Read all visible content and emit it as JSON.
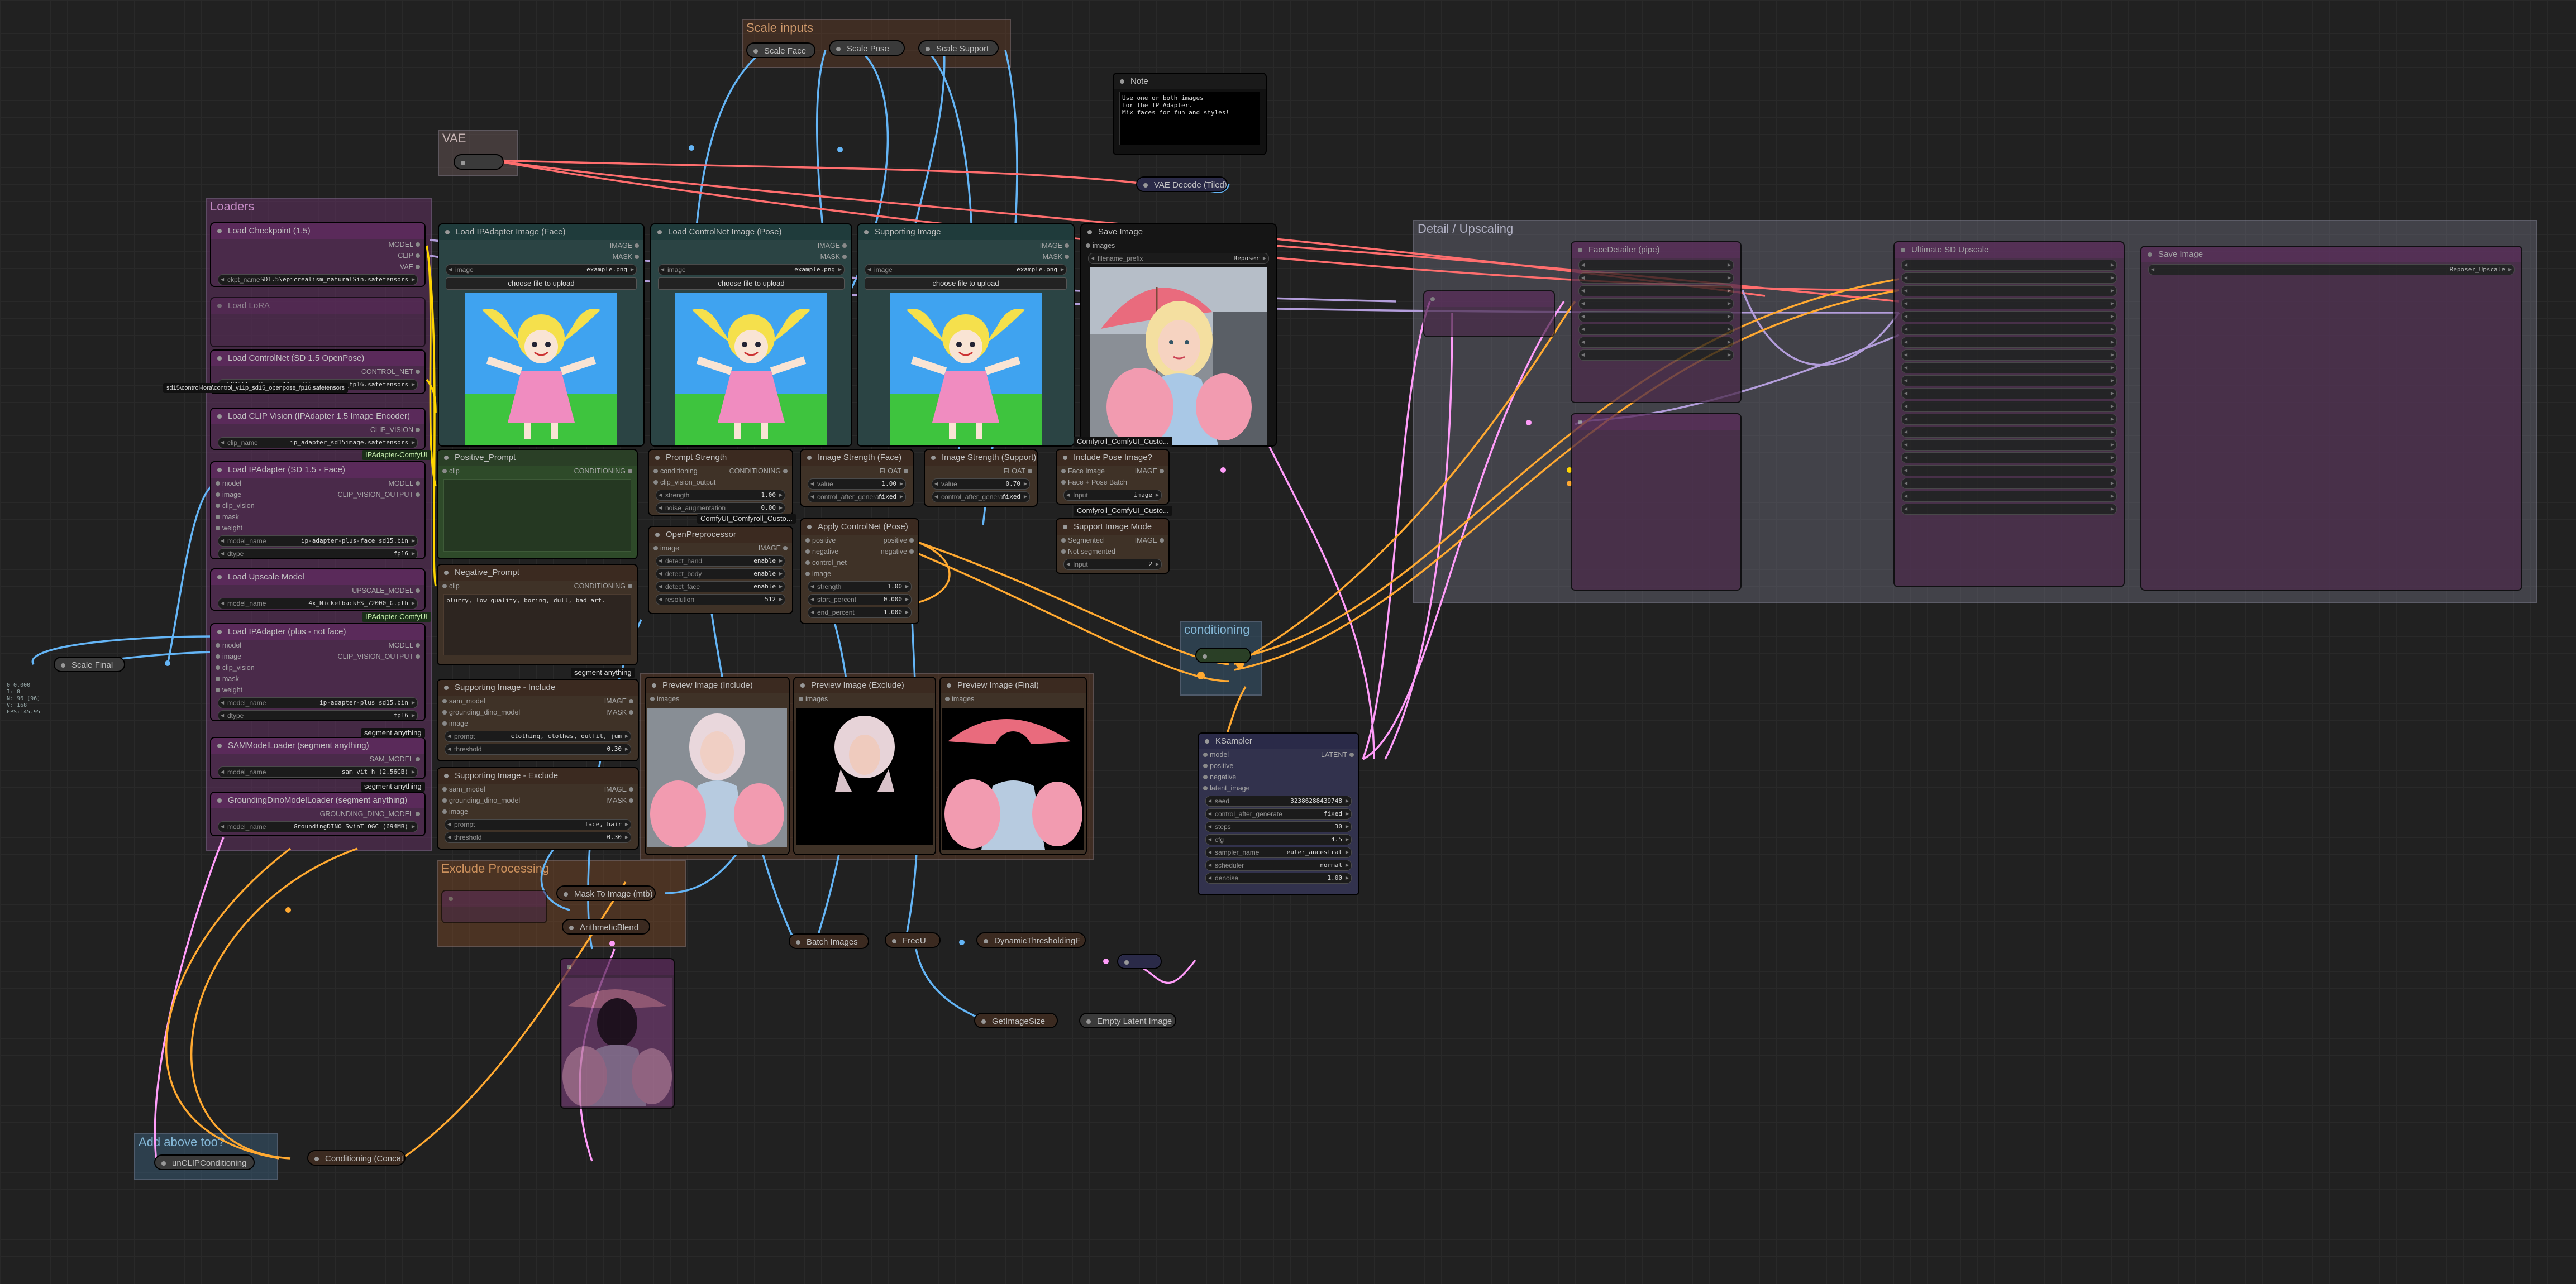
{
  "groups": {
    "scale_inputs": "Scale inputs",
    "vae": "VAE",
    "loaders": "Loaders",
    "detail_upscaling": "Detail / Upscaling",
    "conditioning": "conditioning",
    "exclude_processing": "Exclude Processing",
    "add_above": "Add above too?"
  },
  "nodes": {
    "scale_face": "Scale Face",
    "scale_pose": "Scale Pose",
    "scale_support": "Scale Support",
    "scale_final": "Scale Final",
    "note": {
      "title": "Note",
      "text": "Use one or both images\nfor the IP Adapter.\nMix faces for fun and styles!"
    },
    "vae_decode": "VAE Decode (Tiled)",
    "load_checkpoint": {
      "title": "Load Checkpoint (1.5)",
      "outs": [
        "MODEL",
        "CLIP",
        "VAE"
      ],
      "ckpt_label": "ckpt_name",
      "ckpt_value": "SD1.5\\epicrealism_naturalSin.safetensors"
    },
    "lora": {
      "title": "Load LoRA"
    },
    "load_controlnet": {
      "title": "Load ControlNet (SD 1.5 OpenPose)",
      "out": "CONTROL_NET",
      "label": "control_net_name",
      "value": "SD1.5\\control_v11p_sd15_openpose_fp16.safetensors",
      "chip": "sd15\\control-lora\\control_v11p_sd15_openpose_fp16.safetensors"
    },
    "load_clip_vision": {
      "title": "Load CLIP Vision (IPAdapter 1.5 Image Encoder)",
      "out": "CLIP_VISION",
      "label": "clip_name",
      "value": "ip_adapter_sd15image.safetensors"
    },
    "ipa_face": {
      "title": "Load IPAdapter (SD 1.5 - Face)",
      "ins": [
        "model",
        "image",
        "clip_vision",
        "mask",
        "weight"
      ],
      "outs": [
        "MODEL",
        "CLIP_VISION_OUTPUT"
      ],
      "w1l": "model_name",
      "w1v": "ip-adapter-plus-face_sd15.bin",
      "w2l": "dtype",
      "w2v": "fp16"
    },
    "upscale_model": {
      "title": "Load Upscale Model",
      "out": "UPSCALE_MODEL",
      "label": "model_name",
      "value": "4x_NickelbackFS_72000_G.pth"
    },
    "ipa_plus": {
      "title": "Load IPAdapter (plus - not face)",
      "ins": [
        "model",
        "image",
        "clip_vision",
        "mask",
        "weight"
      ],
      "outs": [
        "MODEL",
        "CLIP_VISION_OUTPUT"
      ],
      "w1l": "model_name",
      "w1v": "ip-adapter-plus_sd15.bin",
      "w2l": "dtype",
      "w2v": "fp16"
    },
    "sam": {
      "title": "SAMModelLoader (segment anything)",
      "out": "SAM_MODEL",
      "label": "model_name",
      "value": "sam_vit_h (2.56GB)"
    },
    "grounding": {
      "title": "GroundingDinoModelLoader (segment anything)",
      "out": "GROUNDING_DINO_MODEL",
      "label": "model_name",
      "value": "GroundingDINO_SwinT_OGC (694MB)"
    },
    "ipa_image_face": {
      "title": "Load IPAdapter Image (Face)",
      "outs": [
        "IMAGE",
        "MASK"
      ],
      "label": "image",
      "value": "example.png",
      "button": "choose file to upload"
    },
    "cn_image_pose": {
      "title": "Load ControlNet Image (Pose)",
      "outs": [
        "IMAGE",
        "MASK"
      ],
      "label": "image",
      "value": "example.png",
      "button": "choose file to upload"
    },
    "supporting_image": {
      "title": "Supporting Image",
      "outs": [
        "IMAGE",
        "MASK"
      ],
      "label": "image",
      "value": "example.png",
      "button": "choose file to upload"
    },
    "save_image": {
      "title": "Save Image",
      "in": "images",
      "prefix_value": "filename_prefix",
      "prefix_text": "Reposer"
    },
    "positive_prompt": {
      "title": "Positive_Prompt",
      "in": "clip",
      "out": "CONDITIONING"
    },
    "negative_prompt": {
      "title": "Negative_Prompt",
      "in": "clip",
      "out": "CONDITIONING",
      "text": "blurry, low quality, boring, dull, bad art."
    },
    "prompt_strength": {
      "title": "Prompt Strength",
      "ins": [
        "conditioning",
        "clip_vision_output"
      ],
      "out": "CONDITIONING",
      "w1l": "strength",
      "w1v": "1.00",
      "w2l": "noise_augmentation",
      "w2v": "0.00"
    },
    "img_strength_face": {
      "title": "Image Strength (Face)",
      "out": "FLOAT",
      "w1l": "value",
      "w1v": "1.00",
      "w2l": "control_after_generate",
      "w2v": "fixed"
    },
    "img_strength_support": {
      "title": "Image Strength (Support)",
      "out": "FLOAT",
      "w1l": "value",
      "w1v": "0.70",
      "w2l": "control_after_generate",
      "w2v": "fixed"
    },
    "include_pose": {
      "title": "Include Pose Image?",
      "ins": [
        "Face Image",
        "Face + Pose Batch"
      ],
      "out": "IMAGE",
      "w1l": "Input",
      "w1v": "image"
    },
    "openpose": {
      "title": "OpenPreprocessor",
      "in": "image",
      "out": "IMAGE",
      "w": [
        [
          "detect_hand",
          "enable"
        ],
        [
          "detect_body",
          "enable"
        ],
        [
          "detect_face",
          "enable"
        ],
        [
          "resolution",
          "512"
        ]
      ]
    },
    "apply_controlnet": {
      "title": "Apply ControlNet (Pose)",
      "ins": [
        "positive",
        "negative",
        "control_net",
        "image"
      ],
      "outs": [
        "positive",
        "negative"
      ],
      "w": [
        [
          "strength",
          "1.00"
        ],
        [
          "start_percent",
          "0.000"
        ],
        [
          "end_percent",
          "1.000"
        ]
      ]
    },
    "support_mode": {
      "title": "Support Image Mode",
      "ins": [
        "Segmented",
        "Not segmented"
      ],
      "out": "IMAGE",
      "w1l": "Input",
      "w1v": "2"
    },
    "support_include": {
      "title": "Supporting Image - Include",
      "ins": [
        "sam_model",
        "grounding_dino_model",
        "image"
      ],
      "outs": [
        "IMAGE",
        "MASK"
      ],
      "w1l": "prompt",
      "w1v": "clothing, clothes, outfit, jum",
      "w2l": "threshold",
      "w2v": "0.30"
    },
    "support_exclude": {
      "title": "Supporting Image - Exclude",
      "ins": [
        "sam_model",
        "grounding_dino_model",
        "image"
      ],
      "outs": [
        "IMAGE",
        "MASK"
      ],
      "w1l": "prompt",
      "w1v": "face, hair",
      "w2l": "threshold",
      "w2v": "0.30"
    },
    "preview_include": {
      "title": "Preview Image (Include)",
      "in": "images"
    },
    "preview_exclude": {
      "title": "Preview Image (Exclude)",
      "in": "images"
    },
    "preview_final": {
      "title": "Preview Image (Final)",
      "in": "images"
    },
    "ksampler": {
      "title": "KSampler",
      "ins": [
        "model",
        "positive",
        "negative",
        "latent_image"
      ],
      "out": "LATENT",
      "w": [
        [
          "seed",
          "32386288439748"
        ],
        [
          "control_after_generate",
          "fixed"
        ],
        [
          "steps",
          "30"
        ],
        [
          "cfg",
          "4.5"
        ],
        [
          "sampler_name",
          "euler_ancestral"
        ],
        [
          "scheduler",
          "normal"
        ],
        [
          "denoise",
          "1.00"
        ]
      ]
    },
    "mask_to_image": "Mask To Image (mtb)",
    "arithmetic_blend": "ArithmeticBlend",
    "batch_images": "Batch Images",
    "freeu": "FreeU",
    "dynamic_threshold": "DynamicThresholdingF",
    "get_image_size": "GetImageSize",
    "empty_latent": "Empty Latent Image",
    "unclip": "unCLIPConditioning",
    "conditioning_concat": "Conditioning (Concat)",
    "detail_nodes": {
      "face_detailer": "FaceDetailer (pipe)",
      "upscale": "Ultimate SD Upscale",
      "save": "Save Image",
      "prefix_text": "Reposer_Upscale"
    }
  },
  "chips": {
    "ipadapter_1": "IPAdapter-ComfyUI",
    "ipadapter_2": "IPAdapter-ComfyUI",
    "segment_1": "segment anything",
    "segment_2": "segment anything",
    "segment_3": "segment anything",
    "comfyui_custom_1": "Comfyroll_ComfyUI_Custo...",
    "comfyui_custom_2": "Comfyroll_ComfyUI_Custo...",
    "comfyui_controlnet": "ComfyUI_Comfyroll_Custo..."
  },
  "stats": "0 0.000\nI: 0\nN: 96 [96]\nV: 168\nFPS:145.95",
  "colors": {
    "background": "#212121",
    "loaders_group": "#4a2a4a",
    "teal_node": "#2b4444",
    "green_node": "#2e4a29",
    "brown_node": "#3f3227",
    "navy_node": "#32324d",
    "wire_model": "#b39ddb",
    "wire_clip": "#ffd500",
    "wire_vae": "#ff6e6e",
    "wire_image": "#64b5f6",
    "wire_conditioning": "#ffa931",
    "wire_latent": "#ff9cf9"
  }
}
